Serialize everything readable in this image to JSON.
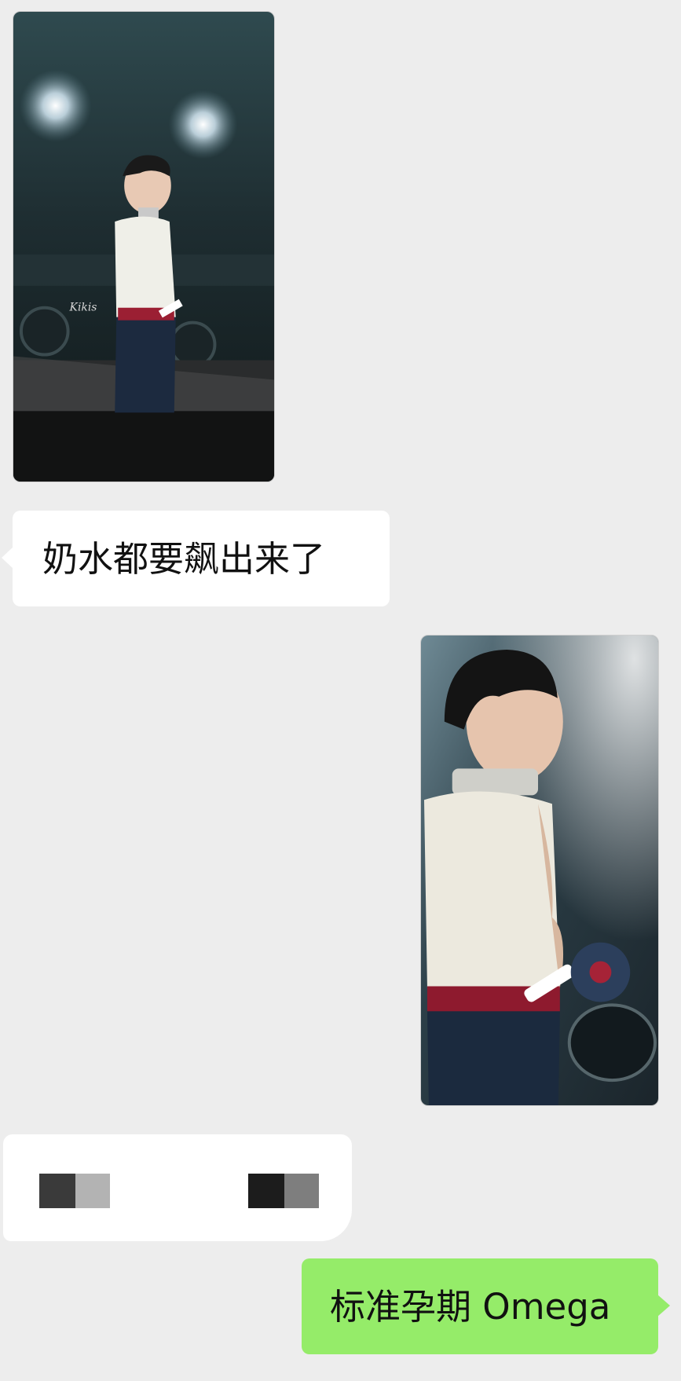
{
  "chat": {
    "messages": [
      {
        "type": "image",
        "side": "left",
        "content": "concert-photo-performer-white-tank-top-wide"
      },
      {
        "type": "text",
        "side": "left",
        "text": "奶水都要飙出来了"
      },
      {
        "type": "image",
        "side": "right",
        "content": "concert-photo-performer-white-tank-top-closeup"
      },
      {
        "type": "text",
        "side": "left",
        "text": "",
        "redacted": true
      },
      {
        "type": "text",
        "side": "right",
        "text": "标准孕期 Omega"
      }
    ]
  },
  "colors": {
    "background": "#ededed",
    "incoming_bubble": "#ffffff",
    "outgoing_bubble": "#95ec69",
    "text": "#111111"
  },
  "photo_watermark": "Kikis"
}
